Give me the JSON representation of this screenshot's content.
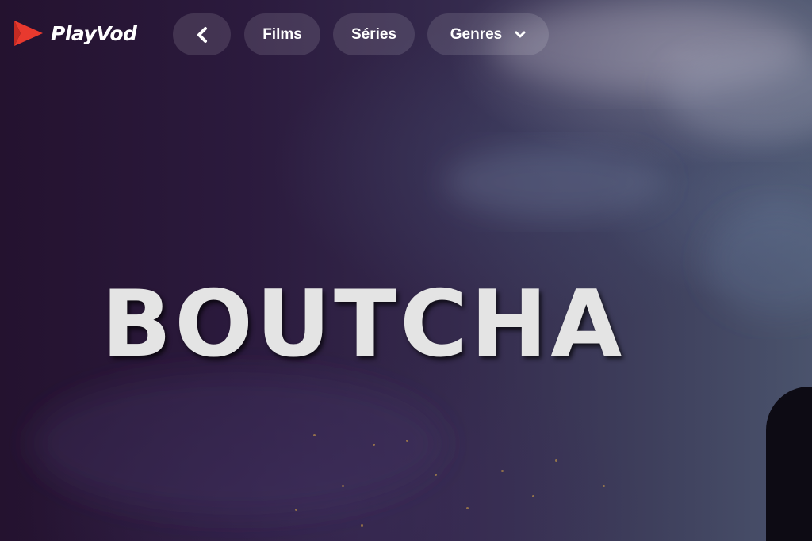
{
  "brand": {
    "name": "PlayVod",
    "accent_color": "#e8392e"
  },
  "nav": {
    "back_icon": "chevron-left-icon",
    "items": [
      {
        "label": "Films"
      },
      {
        "label": "Séries"
      },
      {
        "label": "Genres",
        "icon": "chevron-down-icon"
      }
    ]
  },
  "hero": {
    "title": "BOUTCHA"
  }
}
